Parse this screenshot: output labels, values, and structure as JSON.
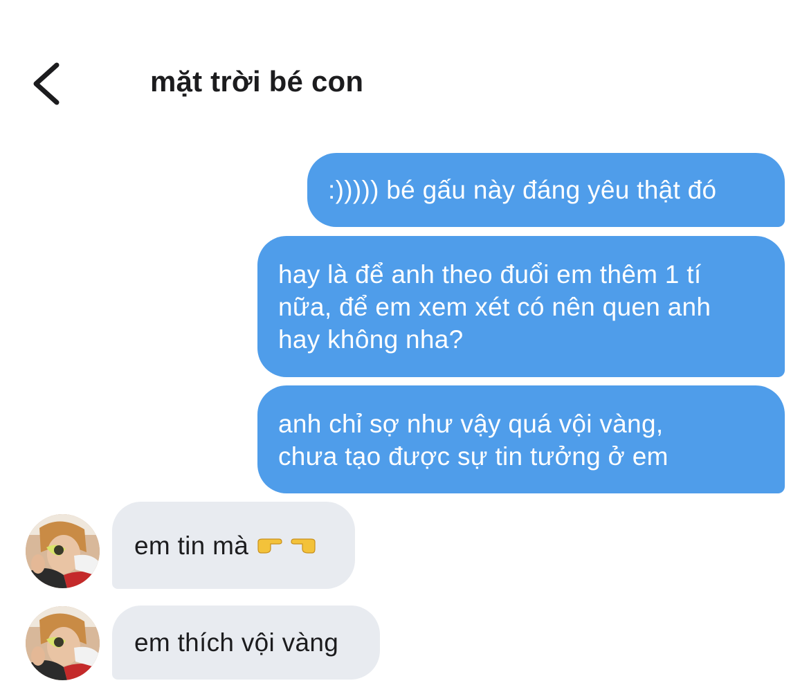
{
  "header": {
    "back_icon": "chevron-left-icon",
    "title": "mặt trời bé con"
  },
  "messages": [
    {
      "direction": "outgoing",
      "text": ":))))) bé gấu này đáng yêu thật đó"
    },
    {
      "direction": "outgoing",
      "lines": [
        "hay là để anh theo đuổi em thêm 1 tí",
        "nữa, để em xem xét có nên quen anh",
        "hay không nha?"
      ]
    },
    {
      "direction": "outgoing",
      "lines": [
        "anh chỉ sợ như vậy quá vội vàng,",
        "chưa tạo được sự tin tưởng ở em"
      ]
    },
    {
      "direction": "incoming",
      "text": "em tin mà",
      "emoji": [
        "pointing-right-icon",
        "pointing-left-icon"
      ]
    },
    {
      "direction": "incoming",
      "text": "em thích vội vàng"
    }
  ],
  "colors": {
    "outgoing_bubble": "#4f9dea",
    "incoming_bubble": "#e8ebf0",
    "title_text": "#1c1c1e"
  }
}
